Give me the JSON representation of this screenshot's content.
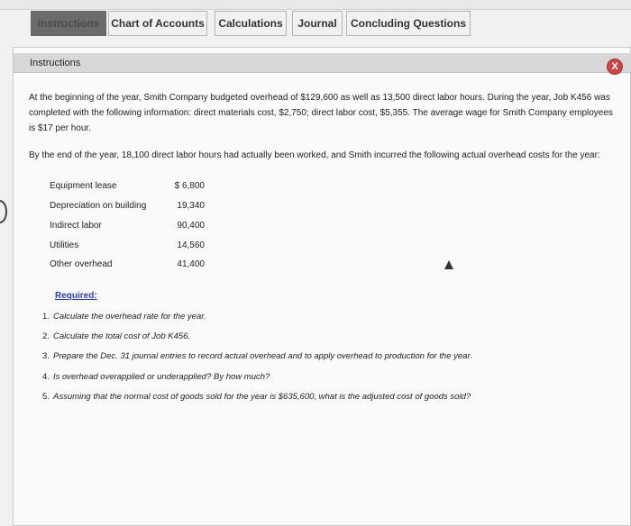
{
  "tabs": [
    {
      "label": "Instructions",
      "active": true
    },
    {
      "label": "Chart of Accounts",
      "active": false
    },
    {
      "label": "Calculations",
      "active": false
    },
    {
      "label": "Journal",
      "active": false
    },
    {
      "label": "Concluding Questions",
      "active": false
    }
  ],
  "panel": {
    "title": "Instructions",
    "close_label": "X",
    "intro_paragraph": "At the beginning of the year, Smith Company budgeted overhead of $129,600 as well as 13,500 direct labor hours. During the year, Job K456 was completed with the following information: direct materials cost, $2,750; direct labor cost, $5,355. The average wage for Smith Company employees is $17 per hour.",
    "second_paragraph": "By the end of the year, 18,100 direct labor hours had actually been worked, and Smith incurred the following actual overhead costs for the year:",
    "costs": [
      {
        "label": "Equipment lease",
        "value": "$ 6,800"
      },
      {
        "label": "Depreciation on building",
        "value": "19,340"
      },
      {
        "label": "Indirect labor",
        "value": "90,400"
      },
      {
        "label": "Utilities",
        "value": "14,560"
      },
      {
        "label": "Other overhead",
        "value": "41,400"
      }
    ],
    "required_heading": "Required:",
    "requirements": [
      {
        "num": "1.",
        "text": "Calculate the overhead rate for the year."
      },
      {
        "num": "2.",
        "text": "Calculate the total cost of Job K456."
      },
      {
        "num": "3.",
        "text": "Prepare the Dec. 31 journal entries to record actual overhead and to apply overhead to production for the year."
      },
      {
        "num": "4.",
        "text": "Is overhead overapplied or underapplied? By how much?"
      },
      {
        "num": "5.",
        "text": "Assuming that the normal cost of goods sold for the year is $635,600, what is the adjusted cost of goods sold?"
      }
    ]
  },
  "colors": {
    "active_tab": "#6b6b6b",
    "close_button": "#c84646",
    "required_link": "#2a3f9d"
  }
}
